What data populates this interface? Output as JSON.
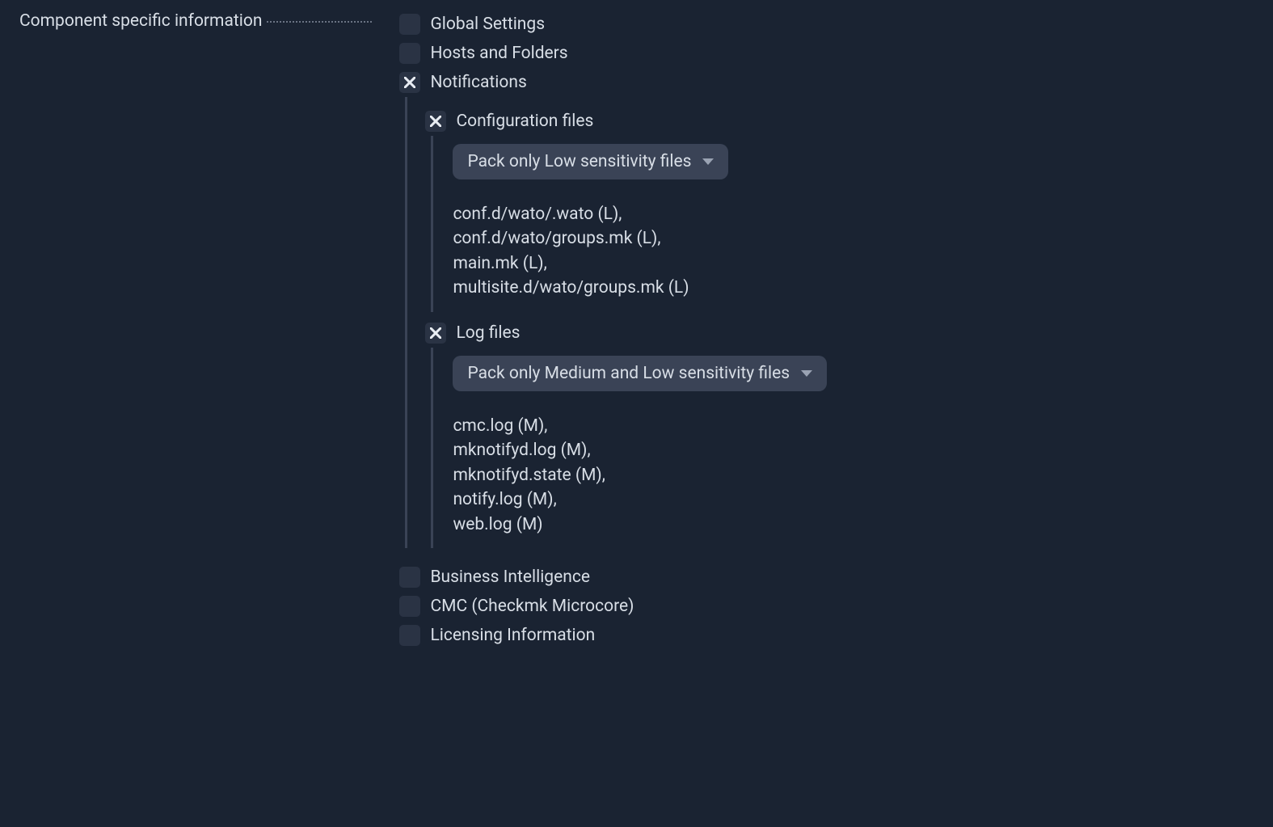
{
  "label": "Component specific information",
  "items": [
    {
      "label": "Global Settings",
      "checked": false
    },
    {
      "label": "Hosts and Folders",
      "checked": false
    },
    {
      "label": "Notifications",
      "checked": true,
      "children": [
        {
          "label": "Configuration files",
          "checked": true,
          "dropdown": "Pack only Low sensitivity files",
          "files": [
            "conf.d/wato/.wato (L),",
            "conf.d/wato/groups.mk (L),",
            "main.mk (L),",
            "multisite.d/wato/groups.mk (L)"
          ]
        },
        {
          "label": "Log files",
          "checked": true,
          "dropdown": "Pack only Medium and Low sensitivity files",
          "files": [
            "cmc.log (M),",
            "mknotifyd.log (M),",
            "mknotifyd.state (M),",
            "notify.log (M),",
            "web.log (M)"
          ]
        }
      ]
    },
    {
      "label": "Business Intelligence",
      "checked": false
    },
    {
      "label": "CMC (Checkmk Microcore)",
      "checked": false
    },
    {
      "label": "Licensing Information",
      "checked": false
    }
  ]
}
